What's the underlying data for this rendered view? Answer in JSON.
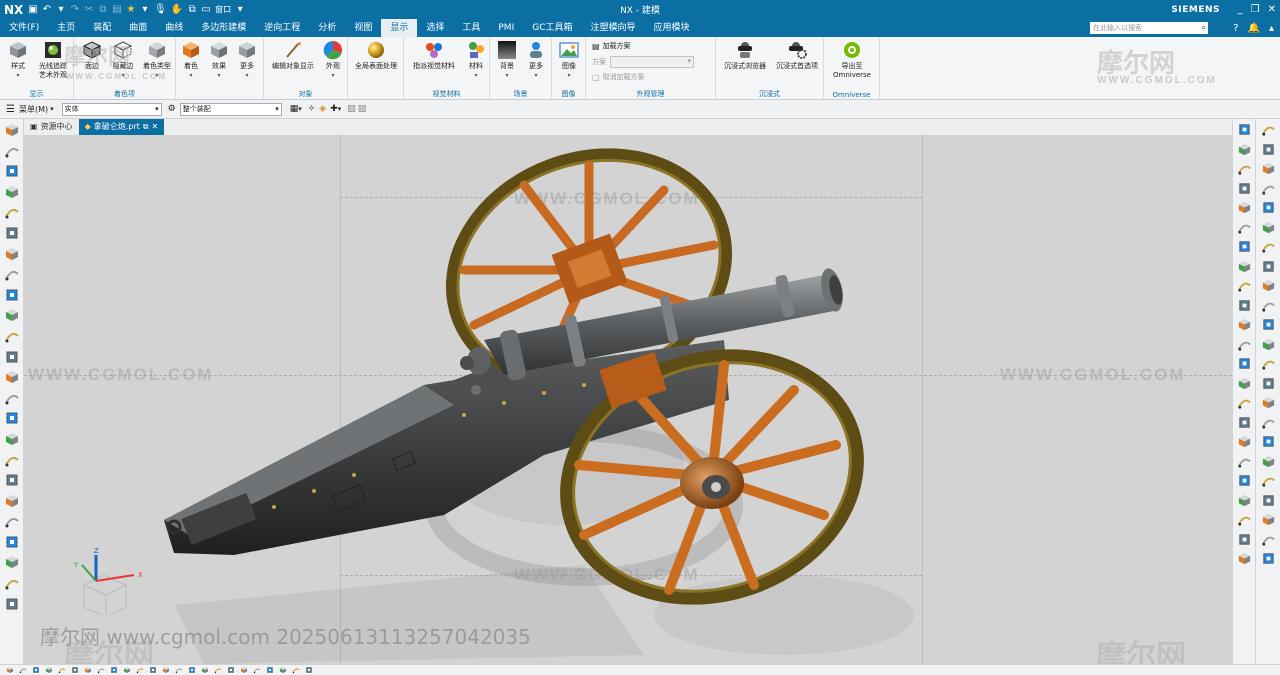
{
  "titlebar": {
    "app_logo": "NX",
    "window_title": "NX - 建模",
    "brand": "SIEMENS",
    "quick_access_icons": [
      "save-icon",
      "undo-icon",
      "redo-icon",
      "cut-icon",
      "copy-icon",
      "paste-icon",
      "star-icon",
      "mic-icon",
      "touch-icon",
      "window-icon"
    ],
    "window_label": "窗口"
  },
  "menubar": {
    "items": [
      "文件(F)",
      "主页",
      "装配",
      "曲面",
      "曲线",
      "多边形建模",
      "逆向工程",
      "分析",
      "视图",
      "显示",
      "选择",
      "工具",
      "PMI",
      "GC工具箱",
      "注塑模向导",
      "应用模块"
    ],
    "active_index": 9,
    "search_placeholder": "在此输入以搜索"
  },
  "ribbon": {
    "groups": [
      {
        "title": "显示",
        "buttons": [
          "样式",
          "光线追踪\n艺术外观"
        ]
      },
      {
        "title": "着色项",
        "buttons": [
          "面边",
          "隐藏边",
          "着色类型"
        ]
      },
      {
        "title": "",
        "buttons": [
          "着色",
          "效果",
          "更多"
        ]
      },
      {
        "title": "对象",
        "buttons": [
          "编辑对象显示",
          "外观"
        ]
      },
      {
        "title": "",
        "buttons": [
          "全局表面处理"
        ]
      },
      {
        "title": "视觉材料",
        "buttons": [
          "指派视觉材料",
          "材料"
        ]
      },
      {
        "title": "场景",
        "buttons": [
          "背景",
          "更多"
        ]
      },
      {
        "title": "图像",
        "buttons": [
          "图像"
        ]
      },
      {
        "title": "外观管理",
        "buttons": [
          "加载方案",
          "方案",
          "取消加载方案"
        ]
      },
      {
        "title": "沉浸式",
        "buttons": [
          "沉浸式浏览器",
          "沉浸式首选项"
        ]
      },
      {
        "title": "Omniverse",
        "buttons": [
          "导出至\nOmniverse"
        ]
      }
    ]
  },
  "selbar": {
    "menu_label": "菜单(M)",
    "filter_value": "实体",
    "assembly_value": "整个装配"
  },
  "tabs": [
    {
      "label": "资源中心",
      "active": false
    },
    {
      "label": "拿破仑炮.prt",
      "active": true
    }
  ],
  "viewport": {
    "watermark_url": "WWW.CGMOL.COM",
    "watermark_cn": "摩尔网",
    "footer_watermark": "摩尔网 www.cgmol.com 20250613113257042035",
    "axes": {
      "x": "X",
      "y": "Y",
      "z": "Z"
    }
  },
  "colors": {
    "accent": "#0b6fa4",
    "wheel_rim": "#6f5a1c",
    "wheel_spoke": "#c8641e",
    "barrel": "#5d5f61",
    "carriage": "#3a3b3c"
  }
}
